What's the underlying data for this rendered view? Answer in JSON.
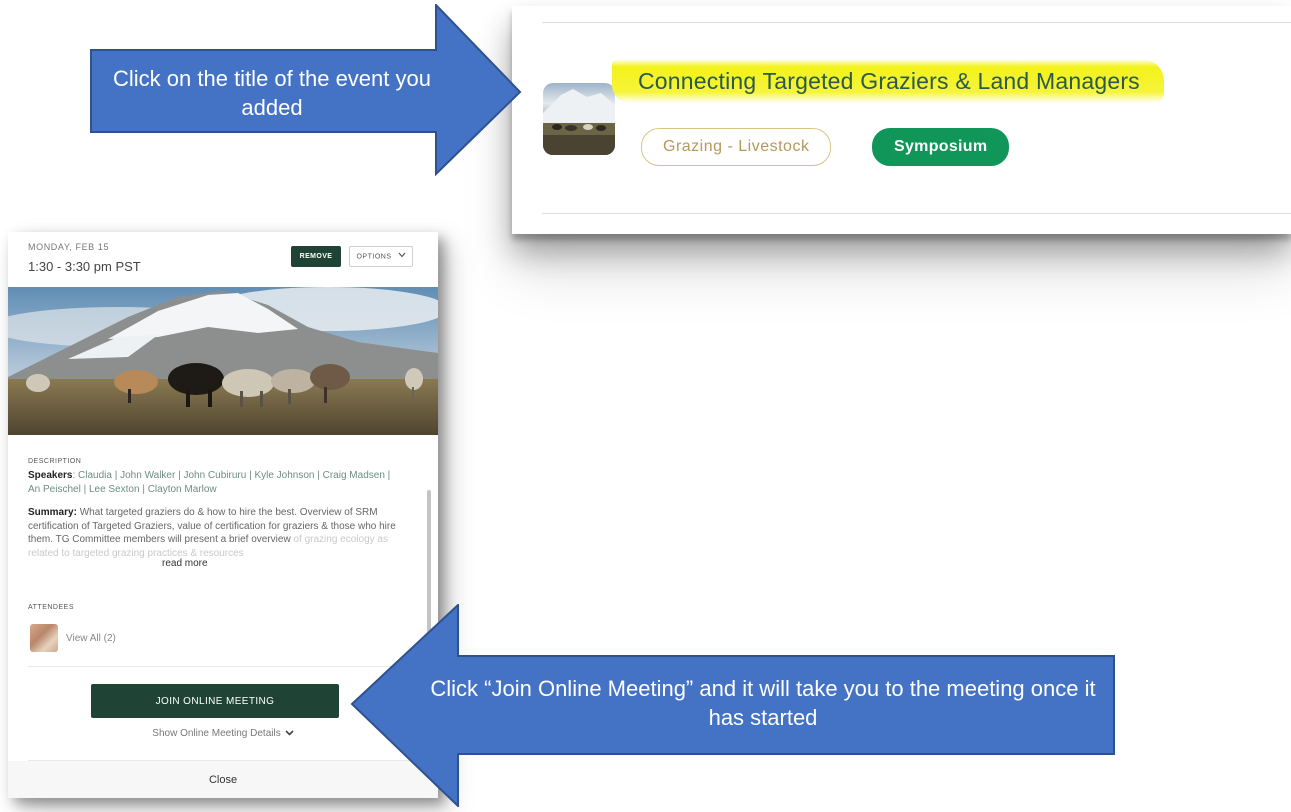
{
  "callouts": {
    "title_click": "Click on the title of the event you added",
    "join_click": "Click “Join Online Meeting” and it will take you to the meeting once it has started"
  },
  "event_card": {
    "title": "Connecting Targeted Graziers & Land Managers",
    "tags": [
      "Grazing - Livestock",
      "Symposium"
    ]
  },
  "modal": {
    "date": "MONDAY, FEB 15",
    "time": "1:30 - 3:30 pm PST",
    "remove_label": "REMOVE",
    "options_label": "OPTIONS",
    "description_label": "DESCRIPTION",
    "speakers_label": "Speakers",
    "speakers_names": "Claudia | John Walker | John Cubiruru | Kyle Johnson | Craig Madsen | An Peischel | Lee Sexton | Clayton Marlow",
    "summary_label": "Summary:",
    "summary_visible": "What targeted graziers do & how to hire the best. Overview of SRM certification of Targeted Graziers, value of certification for graziers & those who hire them. TG Committee members will present a brief overview",
    "summary_faded": "of grazing ecology as related to targeted grazing practices & resources",
    "read_more": "read more",
    "attendees_label": "ATTENDEES",
    "view_all": "View All (2)",
    "join_label": "JOIN ONLINE MEETING",
    "show_details": "Show Online Meeting Details",
    "close_label": "Close"
  },
  "colors": {
    "arrow_fill": "#4472c4",
    "arrow_stroke": "#2f528f",
    "highlight": "#f3f21a",
    "title_text": "#2a5a4c",
    "tag_outline": "#d8c488",
    "tag_green": "#11965a",
    "button_dark_green": "#1f4436"
  },
  "icons": {
    "options_chevron": "chevron-down-icon",
    "details_chevron": "chevron-down-icon"
  }
}
